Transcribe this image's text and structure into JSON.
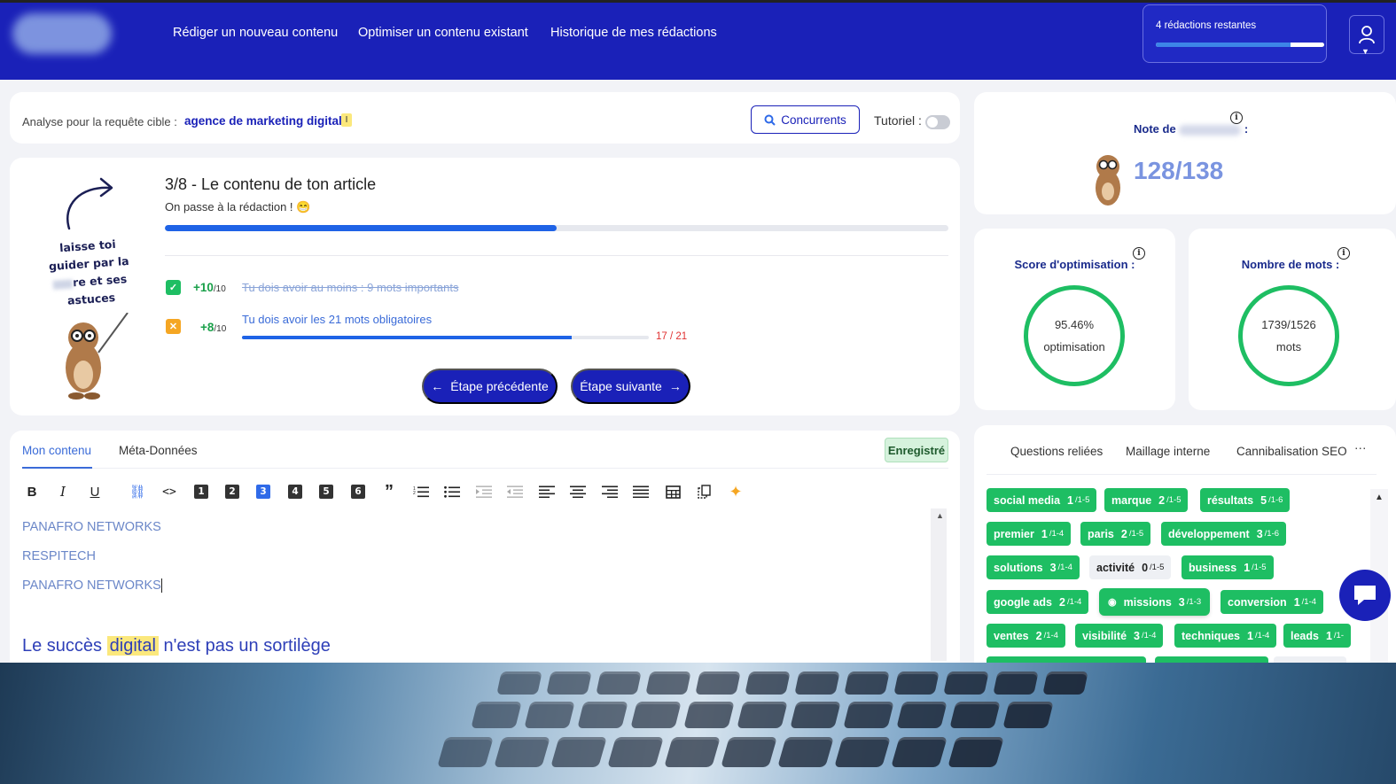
{
  "colors": {
    "brand": "#1a21b8",
    "accent_blue": "#1f63e6",
    "success_green": "#1ebe63",
    "warning": "#f5a623",
    "error_red": "#e03131",
    "highlight_yellow": "#fbe87c"
  },
  "header": {
    "nav": [
      "Rédiger un nouveau contenu",
      "Optimiser un contenu existant",
      "Historique de mes rédactions"
    ],
    "quota_label": "4 rédactions restantes",
    "quota_fraction": 0.8,
    "user_icon": "user-icon"
  },
  "query": {
    "label": "Analyse pour la requête cible :",
    "value": "agence de marketing digital",
    "marker": "I",
    "competitors_label": "Concurrents",
    "tutorial_label": "Tutoriel :",
    "tutorial_on": false
  },
  "guide": {
    "text_lines": [
      "laisse toi",
      "guider par la",
      "re et ses",
      "astuces"
    ]
  },
  "step": {
    "title": "3/8 - Le contenu de ton article",
    "subtitle": "On passe à la rédaction !",
    "emoji": "😁",
    "progress_fraction": 0.5,
    "requirements": [
      {
        "points": "+10",
        "max": "/10",
        "text": "Tu dois avoir au moins : 9 mots importants",
        "status": "done"
      },
      {
        "points": "+8",
        "max": "/10",
        "text": "Tu dois avoir les 21 mots obligatoires",
        "status": "pending",
        "count": "17 / 21",
        "fraction": 0.81
      }
    ],
    "prev_label": "Étape précédente",
    "next_label": "Étape suivante"
  },
  "editor": {
    "tabs": [
      "Mon contenu",
      "Méta-Données"
    ],
    "saved_label": "Enregistré",
    "toolbar": [
      "bold-icon",
      "italic-icon",
      "underline-icon",
      "link-icon",
      "code-icon",
      "heading-1",
      "heading-2",
      "heading-3",
      "heading-4",
      "heading-5",
      "heading-6",
      "quote-icon",
      "ordered-list-icon",
      "bullet-list-icon",
      "indent-icon",
      "outdent-icon",
      "align-left-icon",
      "align-center-icon",
      "align-right-icon",
      "align-justify-icon",
      "table-icon",
      "copy-icon",
      "sparkle-icon"
    ],
    "headings": [
      "1",
      "2",
      "3",
      "4",
      "5",
      "6"
    ],
    "lines": [
      "PANAFRO NETWORKS",
      "RESPITECH",
      "PANAFRO NETWORKS"
    ],
    "heading_before": "Le succès",
    "heading_highlight": "digital",
    "heading_after": "n'est pas un sortilège"
  },
  "note": {
    "label_start": "Note de",
    "label_end": ":",
    "score": "128/138"
  },
  "metrics": {
    "optimisation": {
      "title": "Score d'optimisation :",
      "value": "95.46%",
      "unit": "optimisation"
    },
    "words": {
      "title": "Nombre de mots :",
      "value": "1739/1526",
      "unit": "mots"
    }
  },
  "keywords_panel": {
    "tabs": [
      "Questions reliées",
      "Maillage interne",
      "Cannibalisation SEO",
      "···"
    ],
    "tags": [
      {
        "word": "social media",
        "count": "1",
        "range": "/1-5"
      },
      {
        "word": "marque",
        "count": "2",
        "range": "/1-5"
      },
      {
        "word": "résultats",
        "count": "5",
        "range": "/1-6"
      },
      {
        "word": "premier",
        "count": "1",
        "range": "/1-4"
      },
      {
        "word": "paris",
        "count": "2",
        "range": "/1-5"
      },
      {
        "word": "développement",
        "count": "3",
        "range": "/1-6"
      },
      {
        "word": "solutions",
        "count": "3",
        "range": "/1-4"
      },
      {
        "word": "activité",
        "count": "0",
        "range": "/1-5"
      },
      {
        "word": "business",
        "count": "1",
        "range": "/1-5"
      },
      {
        "word": "google ads",
        "count": "2",
        "range": "/1-4"
      },
      {
        "word": "missions",
        "count": "3",
        "range": "/1-3"
      },
      {
        "word": "conversion",
        "count": "1",
        "range": "/1-4"
      },
      {
        "word": "ventes",
        "count": "2",
        "range": "/1-4"
      },
      {
        "word": "visibilité",
        "count": "3",
        "range": "/1-4"
      },
      {
        "word": "techniques",
        "count": "1",
        "range": "/1-4"
      },
      {
        "word": "leads",
        "count": "1",
        "range": "/1-"
      }
    ]
  },
  "chat": {
    "icon": "chat-icon"
  }
}
